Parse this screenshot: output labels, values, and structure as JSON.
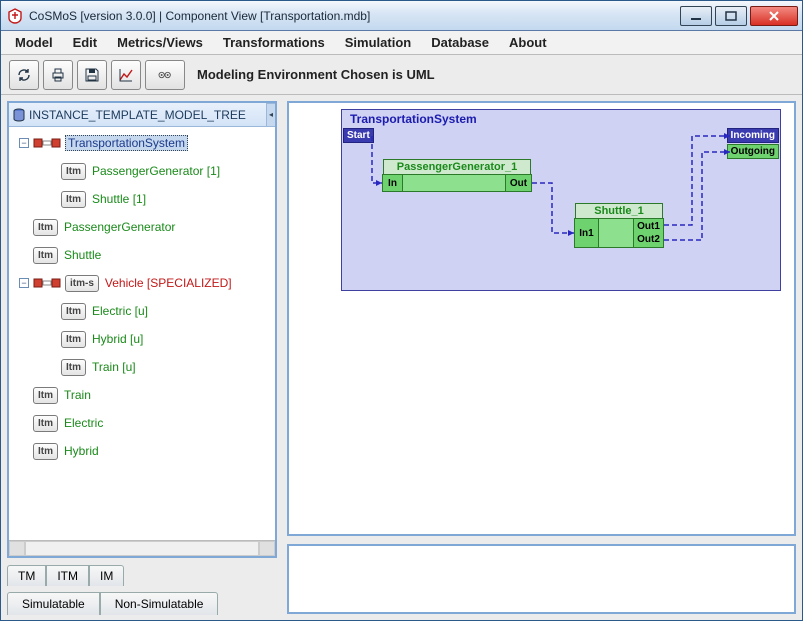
{
  "window": {
    "title": "CoSMoS [version 3.0.0] | Component View [Transportation.mdb]"
  },
  "menubar": [
    "Model",
    "Edit",
    "Metrics/Views",
    "Transformations",
    "Simulation",
    "Database",
    "About"
  ],
  "toolbar": {
    "status": "Modeling Environment Chosen is UML"
  },
  "tree": {
    "header": "INSTANCE_TEMPLATE_MODEL_TREE",
    "items": [
      {
        "indent": 0,
        "toggle": "-",
        "icon": "mdl",
        "badge": "",
        "label": "TransportationSystem",
        "cls": "lbl-blue",
        "sel": true
      },
      {
        "indent": 1,
        "toggle": "",
        "icon": "",
        "badge": "Itm",
        "label": "PassengerGenerator [1]",
        "cls": "lbl-green"
      },
      {
        "indent": 1,
        "toggle": "",
        "icon": "",
        "badge": "Itm",
        "label": "Shuttle [1]",
        "cls": "lbl-green"
      },
      {
        "indent": 0,
        "toggle": "",
        "icon": "",
        "badge": "Itm",
        "label": "PassengerGenerator",
        "cls": "lbl-green"
      },
      {
        "indent": 0,
        "toggle": "",
        "icon": "",
        "badge": "Itm",
        "label": "Shuttle",
        "cls": "lbl-green"
      },
      {
        "indent": 0,
        "toggle": "-",
        "icon": "mdl",
        "badge": "itm-s",
        "label": "Vehicle [SPECIALIZED]",
        "cls": "lbl-red"
      },
      {
        "indent": 1,
        "toggle": "",
        "icon": "",
        "badge": "Itm",
        "label": "Electric [u]",
        "cls": "lbl-green"
      },
      {
        "indent": 1,
        "toggle": "",
        "icon": "",
        "badge": "Itm",
        "label": "Hybrid [u]",
        "cls": "lbl-green"
      },
      {
        "indent": 1,
        "toggle": "",
        "icon": "",
        "badge": "Itm",
        "label": "Train [u]",
        "cls": "lbl-green"
      },
      {
        "indent": 0,
        "toggle": "",
        "icon": "",
        "badge": "Itm",
        "label": "Train",
        "cls": "lbl-green"
      },
      {
        "indent": 0,
        "toggle": "",
        "icon": "",
        "badge": "Itm",
        "label": "Electric",
        "cls": "lbl-green"
      },
      {
        "indent": 0,
        "toggle": "",
        "icon": "",
        "badge": "Itm",
        "label": "Hybrid",
        "cls": "lbl-green"
      }
    ]
  },
  "tabs1": [
    "TM",
    "ITM",
    "IM"
  ],
  "tabs2": [
    "Simulatable",
    "Non-Simulatable"
  ],
  "diagram": {
    "title": "TransportationSystem",
    "start": "Start",
    "incoming": "Incoming",
    "outgoing": "Outgoing",
    "pg": {
      "label": "PassengerGenerator_1",
      "in": "In",
      "out": "Out"
    },
    "sh": {
      "label": "Shuttle_1",
      "in": "In1",
      "out1": "Out1",
      "out2": "Out2"
    }
  }
}
